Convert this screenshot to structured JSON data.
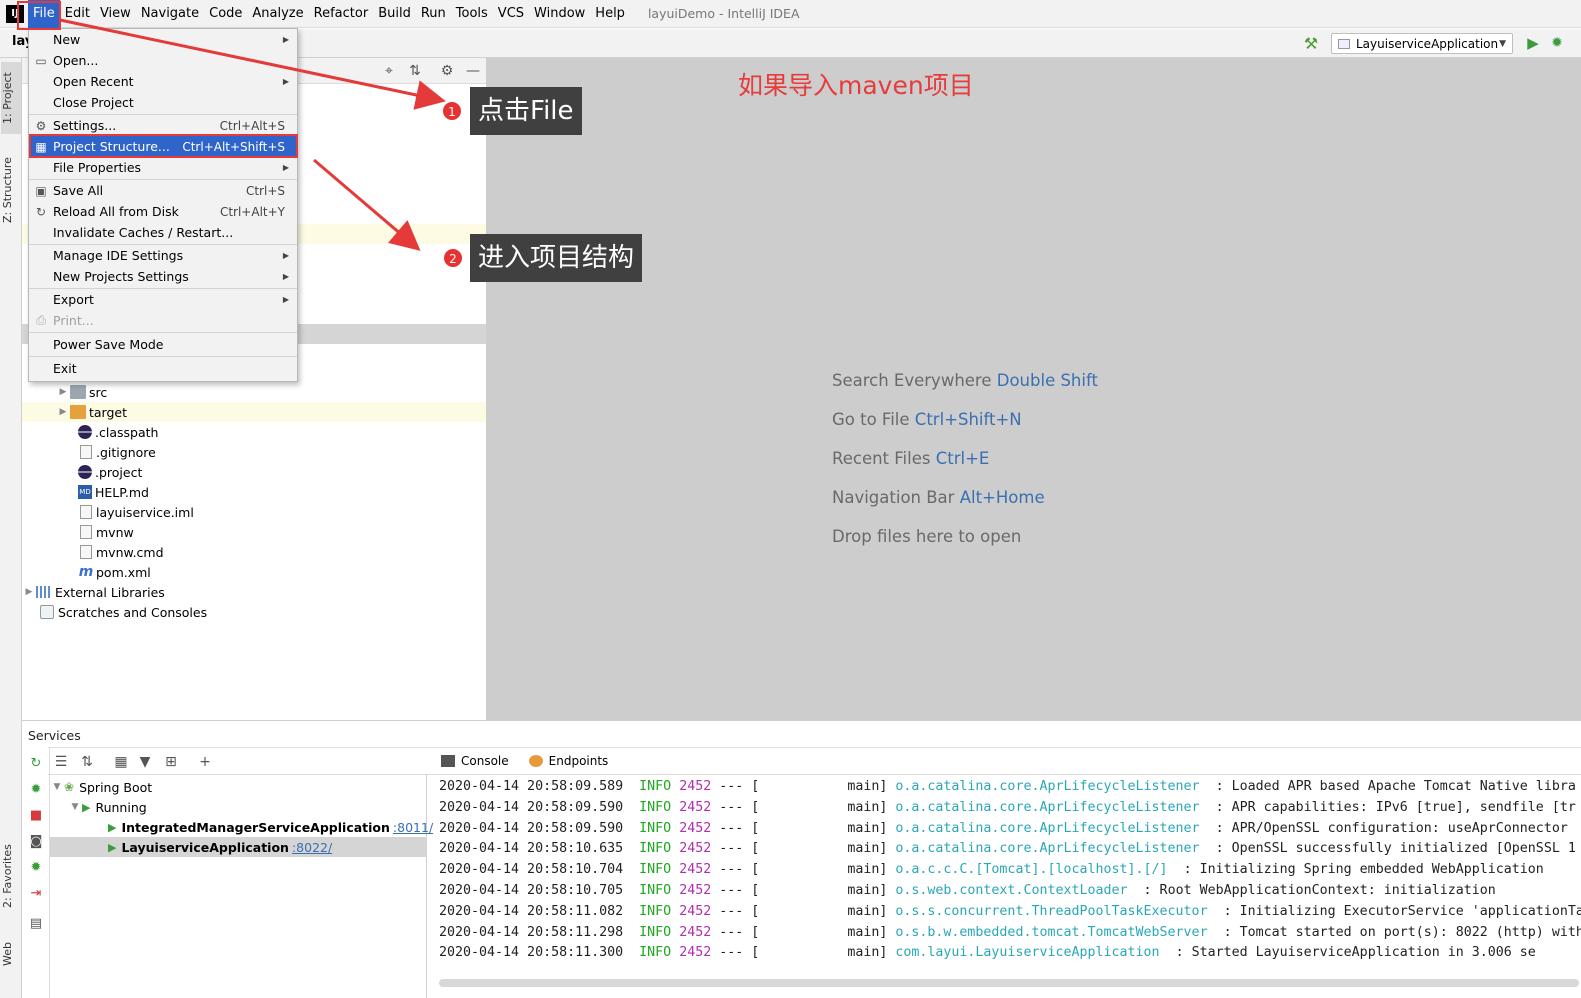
{
  "window": {
    "title": "layuiDemo - IntelliJ IDEA",
    "logo": "IJ",
    "project_short": "lay"
  },
  "menubar": [
    "File",
    "Edit",
    "View",
    "Navigate",
    "Code",
    "Analyze",
    "Refactor",
    "Build",
    "Run",
    "Tools",
    "VCS",
    "Window",
    "Help"
  ],
  "toolbar": {
    "run_config": "LayuiserviceApplication",
    "icons": [
      "hammer-icon",
      "run-icon",
      "debug-icon"
    ]
  },
  "left_stripe": {
    "tabs": [
      "1: Project",
      "Z: Structure",
      "2: Favorites",
      "Web"
    ]
  },
  "file_menu": {
    "items": [
      {
        "label": "New",
        "submenu": true
      },
      {
        "label": "Open...",
        "icon": "folder-icon"
      },
      {
        "label": "Open Recent",
        "submenu": true
      },
      {
        "label": "Close Project"
      },
      {
        "label": "Settings...",
        "shortcut": "Ctrl+Alt+S",
        "icon": "wrench-icon"
      },
      {
        "label": "Project Structure...",
        "shortcut": "Ctrl+Alt+Shift+S",
        "icon": "structure-icon",
        "highlighted": true
      },
      {
        "label": "File Properties",
        "submenu": true
      },
      {
        "label": "Save All",
        "shortcut": "Ctrl+S",
        "icon": "save-icon"
      },
      {
        "label": "Reload All from Disk",
        "shortcut": "Ctrl+Alt+Y",
        "icon": "reload-icon"
      },
      {
        "label": "Invalidate Caches / Restart..."
      },
      {
        "label": "Manage IDE Settings",
        "submenu": true
      },
      {
        "label": "New Projects Settings",
        "submenu": true
      },
      {
        "label": "Export",
        "submenu": true
      },
      {
        "label": "Print...",
        "disabled": true,
        "icon": "print-icon"
      },
      {
        "label": "Power Save Mode"
      },
      {
        "label": "Exit"
      }
    ]
  },
  "project_tree": {
    "items": [
      {
        "label": "src",
        "type": "folder",
        "expandable": true
      },
      {
        "label": "target",
        "type": "folder-target",
        "expandable": true
      },
      {
        "label": ".classpath",
        "type": "eclipse"
      },
      {
        "label": ".gitignore",
        "type": "file"
      },
      {
        "label": ".project",
        "type": "eclipse"
      },
      {
        "label": "HELP.md",
        "type": "md"
      },
      {
        "label": "layuiservice.iml",
        "type": "file"
      },
      {
        "label": "mvnw",
        "type": "file"
      },
      {
        "label": "mvnw.cmd",
        "type": "file"
      },
      {
        "label": "pom.xml",
        "type": "maven"
      },
      {
        "label": "External Libraries",
        "type": "library",
        "expandable": true
      },
      {
        "label": "Scratches and Consoles",
        "type": "scratch"
      }
    ]
  },
  "editor": {
    "hints": [
      {
        "text": "Search Everywhere",
        "key": "Double Shift"
      },
      {
        "text": "Go to File",
        "key": "Ctrl+Shift+N"
      },
      {
        "text": "Recent Files",
        "key": "Ctrl+E"
      },
      {
        "text": "Navigation Bar",
        "key": "Alt+Home"
      },
      {
        "text": "Drop files here to open",
        "key": ""
      }
    ]
  },
  "annotations": {
    "maven_note": "如果导入maven项目",
    "step1_num": "1",
    "step1_text": "点击File",
    "step2_num": "2",
    "step2_text": "进入项目结构",
    "color": "#e43a3a"
  },
  "services": {
    "title": "Services",
    "tree": [
      {
        "label": "Spring Boot",
        "level": 0
      },
      {
        "label": "Running",
        "level": 1
      },
      {
        "label": "IntegratedManagerServiceApplication",
        "port": ":8011/",
        "level": 2
      },
      {
        "label": "LayuiserviceApplication",
        "port": ":8022/",
        "level": 2,
        "selected": true
      }
    ],
    "tabs": [
      "Console",
      "Endpoints"
    ]
  },
  "console": {
    "lines": [
      {
        "ts": "2020-04-14 20:58:09.589",
        "level": "INFO",
        "pid": "2452",
        "thread": "main",
        "logger": "o.a.catalina.core.AprLifecycleListener",
        "msg": ": Loaded APR based Apache Tomcat Native libra"
      },
      {
        "ts": "2020-04-14 20:58:09.590",
        "level": "INFO",
        "pid": "2452",
        "thread": "main",
        "logger": "o.a.catalina.core.AprLifecycleListener",
        "msg": ": APR capabilities: IPv6 [true], sendfile [tr"
      },
      {
        "ts": "2020-04-14 20:58:09.590",
        "level": "INFO",
        "pid": "2452",
        "thread": "main",
        "logger": "o.a.catalina.core.AprLifecycleListener",
        "msg": ": APR/OpenSSL configuration: useAprConnector "
      },
      {
        "ts": "2020-04-14 20:58:10.635",
        "level": "INFO",
        "pid": "2452",
        "thread": "main",
        "logger": "o.a.catalina.core.AprLifecycleListener",
        "msg": ": OpenSSL successfully initialized [OpenSSL 1"
      },
      {
        "ts": "2020-04-14 20:58:10.704",
        "level": "INFO",
        "pid": "2452",
        "thread": "main",
        "logger": "o.a.c.c.C.[Tomcat].[localhost].[/]",
        "msg": ": Initializing Spring embedded WebApplication"
      },
      {
        "ts": "2020-04-14 20:58:10.705",
        "level": "INFO",
        "pid": "2452",
        "thread": "main",
        "logger": "o.s.web.context.ContextLoader",
        "msg": ": Root WebApplicationContext: initialization "
      },
      {
        "ts": "2020-04-14 20:58:11.082",
        "level": "INFO",
        "pid": "2452",
        "thread": "main",
        "logger": "o.s.s.concurrent.ThreadPoolTaskExecutor",
        "msg": ": Initializing ExecutorService 'applicationTa"
      },
      {
        "ts": "2020-04-14 20:58:11.298",
        "level": "INFO",
        "pid": "2452",
        "thread": "main",
        "logger": "o.s.b.w.embedded.tomcat.TomcatWebServer",
        "msg": ": Tomcat started on port(s): 8022 (http) with"
      },
      {
        "ts": "2020-04-14 20:58:11.300",
        "level": "INFO",
        "pid": "2452",
        "thread": "main",
        "logger": "com.layui.LayuiserviceApplication",
        "msg": ": Started LayuiserviceApplication in 3.006 se"
      }
    ]
  }
}
